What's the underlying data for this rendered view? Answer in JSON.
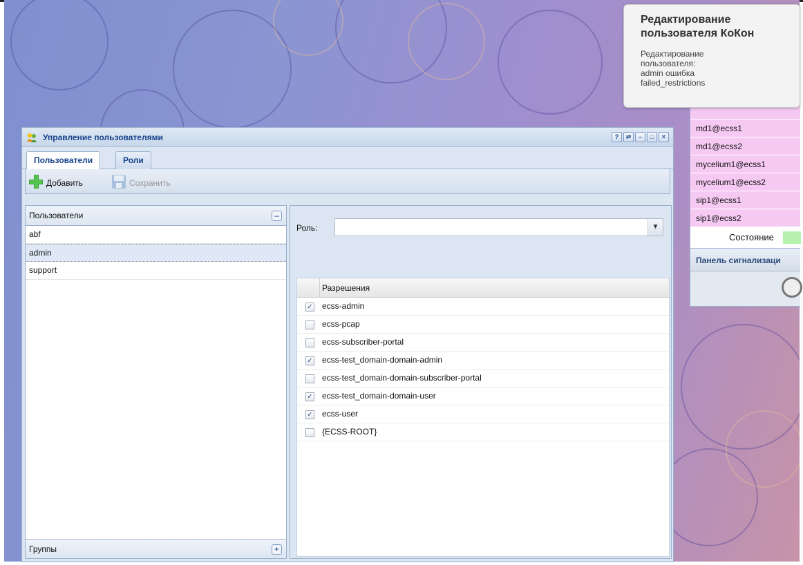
{
  "notification": {
    "title": "Редактирование пользователя КоКон",
    "body": "Редактирование\nпользователя:\nadmin ошибка\nfailed_restrictions"
  },
  "side_panel": {
    "items": [
      "md1@ecss1",
      "md1@ecss2",
      "mycelium1@ecss1",
      "mycelium1@ecss2",
      "sip1@ecss1",
      "sip1@ecss2"
    ],
    "state_label": "Состояние",
    "signal_panel_label": "Панель сигнализаци"
  },
  "window": {
    "title": "Управление пользователями",
    "tools": [
      "?",
      "⇄",
      "–",
      "□",
      "✕"
    ]
  },
  "tabs": [
    {
      "label": "Пользователи",
      "active": true
    },
    {
      "label": "Роли",
      "active": false
    }
  ],
  "toolbar": {
    "add_label": "Добавить",
    "save_label": "Сохранить"
  },
  "users_panel": {
    "header": "Пользователи",
    "users": [
      {
        "name": "abf",
        "selected": false
      },
      {
        "name": "admin",
        "selected": true
      },
      {
        "name": "support",
        "selected": false
      }
    ],
    "groups_header": "Группы"
  },
  "details": {
    "role_label": "Роль:",
    "role_value": "",
    "permissions_header": "Разрешения",
    "permissions": [
      {
        "name": "ecss-admin",
        "checked": true
      },
      {
        "name": "ecss-pcap",
        "checked": false
      },
      {
        "name": "ecss-subscriber-portal",
        "checked": false
      },
      {
        "name": "ecss-test_domain-domain-admin",
        "checked": true
      },
      {
        "name": "ecss-test_domain-domain-subscriber-portal",
        "checked": false
      },
      {
        "name": "ecss-test_domain-domain-user",
        "checked": true
      },
      {
        "name": "ecss-user",
        "checked": true
      },
      {
        "name": "{ECSS-ROOT}",
        "checked": false
      }
    ]
  },
  "colors": {
    "title_text": "#15428b",
    "side_list_bg": "#f6c9f3",
    "state_indicator": "#b8f0b0"
  }
}
